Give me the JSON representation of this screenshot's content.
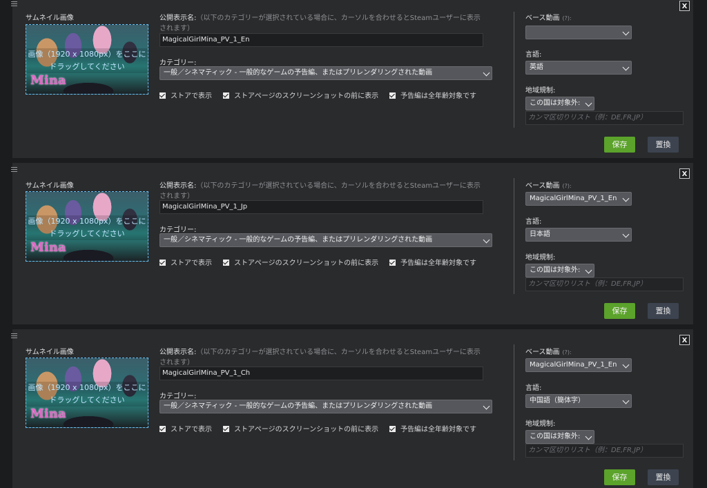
{
  "labels": {
    "thumbnail": "サムネイル画像",
    "drop_text_1": "画像（1920 x 1080px）をここに",
    "drop_text_2": "ドラッグしてください",
    "thumb_logo": "Mina",
    "public_name": "公開表示名:",
    "public_name_hint_1": "（以下のカテゴリーが選択されている場合に、カーソルを合わせるとSteamユーザーに表示",
    "public_name_hint_2": "されます）",
    "category": "カテゴリー:",
    "category_value": "一般／シネマティック - 一般的なゲームの予告編、またはプリレンダリングされた動画",
    "show_in_store": "ストアで表示",
    "show_before_screenshots": "ストアページのスクリーンショットの前に表示",
    "all_ages": "予告編は全年齢対象です",
    "base_video": "ベース動画",
    "base_video_help": "(?):",
    "language": "言語:",
    "region": "地域規制:",
    "region_mode": "この国は対象外:",
    "region_placeholder": "カンマ区切りリスト（例：DE,FR,JP）",
    "save": "保存",
    "replace": "置換",
    "close": "X"
  },
  "panels": [
    {
      "name": "MagicalGirlMina_PV_1_En",
      "base_video": "",
      "language": "英語"
    },
    {
      "name": "MagicalGirlMina_PV_1_Jp",
      "base_video": "MagicalGirlMina_PV_1_En",
      "language": "日本語"
    },
    {
      "name": "MagicalGirlMina_PV_1_Ch",
      "base_video": "MagicalGirlMina_PV_1_En",
      "language": "中国語（簡体字）"
    }
  ]
}
